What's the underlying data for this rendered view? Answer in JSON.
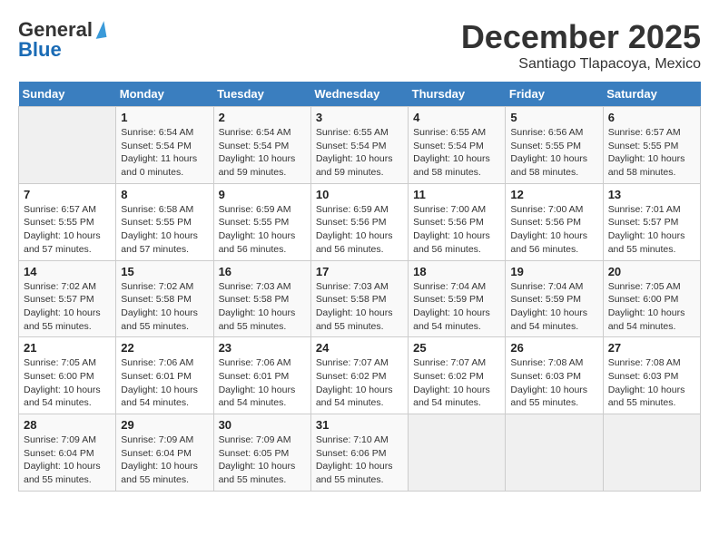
{
  "logo": {
    "general": "General",
    "blue": "Blue"
  },
  "title": "December 2025",
  "subtitle": "Santiago Tlapacoya, Mexico",
  "days_of_week": [
    "Sunday",
    "Monday",
    "Tuesday",
    "Wednesday",
    "Thursday",
    "Friday",
    "Saturday"
  ],
  "weeks": [
    [
      {
        "day": "",
        "info": ""
      },
      {
        "day": "1",
        "info": "Sunrise: 6:54 AM\nSunset: 5:54 PM\nDaylight: 11 hours\nand 0 minutes."
      },
      {
        "day": "2",
        "info": "Sunrise: 6:54 AM\nSunset: 5:54 PM\nDaylight: 10 hours\nand 59 minutes."
      },
      {
        "day": "3",
        "info": "Sunrise: 6:55 AM\nSunset: 5:54 PM\nDaylight: 10 hours\nand 59 minutes."
      },
      {
        "day": "4",
        "info": "Sunrise: 6:55 AM\nSunset: 5:54 PM\nDaylight: 10 hours\nand 58 minutes."
      },
      {
        "day": "5",
        "info": "Sunrise: 6:56 AM\nSunset: 5:55 PM\nDaylight: 10 hours\nand 58 minutes."
      },
      {
        "day": "6",
        "info": "Sunrise: 6:57 AM\nSunset: 5:55 PM\nDaylight: 10 hours\nand 58 minutes."
      }
    ],
    [
      {
        "day": "7",
        "info": "Sunrise: 6:57 AM\nSunset: 5:55 PM\nDaylight: 10 hours\nand 57 minutes."
      },
      {
        "day": "8",
        "info": "Sunrise: 6:58 AM\nSunset: 5:55 PM\nDaylight: 10 hours\nand 57 minutes."
      },
      {
        "day": "9",
        "info": "Sunrise: 6:59 AM\nSunset: 5:55 PM\nDaylight: 10 hours\nand 56 minutes."
      },
      {
        "day": "10",
        "info": "Sunrise: 6:59 AM\nSunset: 5:56 PM\nDaylight: 10 hours\nand 56 minutes."
      },
      {
        "day": "11",
        "info": "Sunrise: 7:00 AM\nSunset: 5:56 PM\nDaylight: 10 hours\nand 56 minutes."
      },
      {
        "day": "12",
        "info": "Sunrise: 7:00 AM\nSunset: 5:56 PM\nDaylight: 10 hours\nand 56 minutes."
      },
      {
        "day": "13",
        "info": "Sunrise: 7:01 AM\nSunset: 5:57 PM\nDaylight: 10 hours\nand 55 minutes."
      }
    ],
    [
      {
        "day": "14",
        "info": "Sunrise: 7:02 AM\nSunset: 5:57 PM\nDaylight: 10 hours\nand 55 minutes."
      },
      {
        "day": "15",
        "info": "Sunrise: 7:02 AM\nSunset: 5:58 PM\nDaylight: 10 hours\nand 55 minutes."
      },
      {
        "day": "16",
        "info": "Sunrise: 7:03 AM\nSunset: 5:58 PM\nDaylight: 10 hours\nand 55 minutes."
      },
      {
        "day": "17",
        "info": "Sunrise: 7:03 AM\nSunset: 5:58 PM\nDaylight: 10 hours\nand 55 minutes."
      },
      {
        "day": "18",
        "info": "Sunrise: 7:04 AM\nSunset: 5:59 PM\nDaylight: 10 hours\nand 54 minutes."
      },
      {
        "day": "19",
        "info": "Sunrise: 7:04 AM\nSunset: 5:59 PM\nDaylight: 10 hours\nand 54 minutes."
      },
      {
        "day": "20",
        "info": "Sunrise: 7:05 AM\nSunset: 6:00 PM\nDaylight: 10 hours\nand 54 minutes."
      }
    ],
    [
      {
        "day": "21",
        "info": "Sunrise: 7:05 AM\nSunset: 6:00 PM\nDaylight: 10 hours\nand 54 minutes."
      },
      {
        "day": "22",
        "info": "Sunrise: 7:06 AM\nSunset: 6:01 PM\nDaylight: 10 hours\nand 54 minutes."
      },
      {
        "day": "23",
        "info": "Sunrise: 7:06 AM\nSunset: 6:01 PM\nDaylight: 10 hours\nand 54 minutes."
      },
      {
        "day": "24",
        "info": "Sunrise: 7:07 AM\nSunset: 6:02 PM\nDaylight: 10 hours\nand 54 minutes."
      },
      {
        "day": "25",
        "info": "Sunrise: 7:07 AM\nSunset: 6:02 PM\nDaylight: 10 hours\nand 54 minutes."
      },
      {
        "day": "26",
        "info": "Sunrise: 7:08 AM\nSunset: 6:03 PM\nDaylight: 10 hours\nand 55 minutes."
      },
      {
        "day": "27",
        "info": "Sunrise: 7:08 AM\nSunset: 6:03 PM\nDaylight: 10 hours\nand 55 minutes."
      }
    ],
    [
      {
        "day": "28",
        "info": "Sunrise: 7:09 AM\nSunset: 6:04 PM\nDaylight: 10 hours\nand 55 minutes."
      },
      {
        "day": "29",
        "info": "Sunrise: 7:09 AM\nSunset: 6:04 PM\nDaylight: 10 hours\nand 55 minutes."
      },
      {
        "day": "30",
        "info": "Sunrise: 7:09 AM\nSunset: 6:05 PM\nDaylight: 10 hours\nand 55 minutes."
      },
      {
        "day": "31",
        "info": "Sunrise: 7:10 AM\nSunset: 6:06 PM\nDaylight: 10 hours\nand 55 minutes."
      },
      {
        "day": "",
        "info": ""
      },
      {
        "day": "",
        "info": ""
      },
      {
        "day": "",
        "info": ""
      }
    ]
  ]
}
